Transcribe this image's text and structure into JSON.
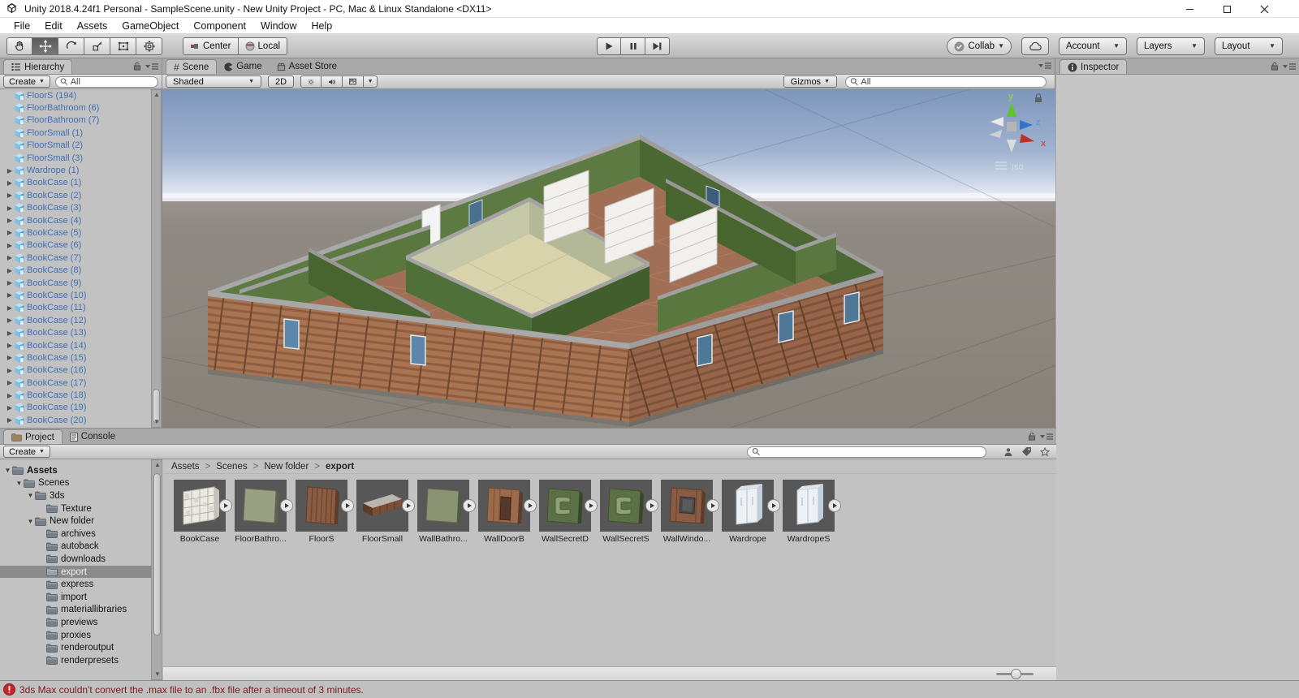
{
  "window": {
    "title": "Unity 2018.4.24f1 Personal - SampleScene.unity - New Unity Project - PC, Mac & Linux Standalone <DX11>"
  },
  "menu": [
    "File",
    "Edit",
    "Assets",
    "GameObject",
    "Component",
    "Window",
    "Help"
  ],
  "toolbar": {
    "tools": [
      "hand",
      "move",
      "rotate",
      "scale",
      "rect",
      "transform"
    ],
    "active_tool": "move",
    "pivot_label": "Center",
    "orientation_label": "Local",
    "collab_label": "Collab",
    "account_label": "Account",
    "layers_label": "Layers",
    "layout_label": "Layout"
  },
  "hierarchy": {
    "tab": "Hierarchy",
    "create_label": "Create",
    "search_value": "All",
    "items": [
      {
        "label": "FloorS (194)",
        "arrow": false
      },
      {
        "label": "FloorBathroom (6)",
        "arrow": false
      },
      {
        "label": "FloorBathroom (7)",
        "arrow": false
      },
      {
        "label": "FloorSmall (1)",
        "arrow": false
      },
      {
        "label": "FloorSmall (2)",
        "arrow": false
      },
      {
        "label": "FloorSmall (3)",
        "arrow": false
      },
      {
        "label": "Wardrope (1)",
        "arrow": true
      },
      {
        "label": "BookCase (1)",
        "arrow": true
      },
      {
        "label": "BookCase (2)",
        "arrow": true
      },
      {
        "label": "BookCase (3)",
        "arrow": true
      },
      {
        "label": "BookCase (4)",
        "arrow": true
      },
      {
        "label": "BookCase (5)",
        "arrow": true
      },
      {
        "label": "BookCase (6)",
        "arrow": true
      },
      {
        "label": "BookCase (7)",
        "arrow": true
      },
      {
        "label": "BookCase (8)",
        "arrow": true
      },
      {
        "label": "BookCase (9)",
        "arrow": true
      },
      {
        "label": "BookCase (10)",
        "arrow": true
      },
      {
        "label": "BookCase (11)",
        "arrow": true
      },
      {
        "label": "BookCase (12)",
        "arrow": true
      },
      {
        "label": "BookCase (13)",
        "arrow": true
      },
      {
        "label": "BookCase (14)",
        "arrow": true
      },
      {
        "label": "BookCase (15)",
        "arrow": true
      },
      {
        "label": "BookCase (16)",
        "arrow": true
      },
      {
        "label": "BookCase (17)",
        "arrow": true
      },
      {
        "label": "BookCase (18)",
        "arrow": true
      },
      {
        "label": "BookCase (19)",
        "arrow": true
      },
      {
        "label": "BookCase (20)",
        "arrow": true
      }
    ]
  },
  "scene": {
    "tabs": [
      "Scene",
      "Game",
      "Asset Store"
    ],
    "shading_label": "Shaded",
    "toggle_2d": "2D",
    "gizmos_label": "Gizmos",
    "search_value": "All",
    "axis_labels": {
      "x": "x",
      "y": "y",
      "z": "z"
    },
    "view_mode_label": "Iso"
  },
  "inspector": {
    "tab": "Inspector"
  },
  "project": {
    "tabs": [
      "Project",
      "Console"
    ],
    "create_label": "Create",
    "search_value": "",
    "breadcrumb": [
      "Assets",
      "Scenes",
      "New folder",
      "export"
    ],
    "breadcrumb_sep": ">",
    "tree": [
      {
        "label": "Assets",
        "depth": 0,
        "expanded": true,
        "bold": true,
        "selected": false
      },
      {
        "label": "Scenes",
        "depth": 1,
        "expanded": true,
        "bold": false,
        "selected": false
      },
      {
        "label": "3ds",
        "depth": 2,
        "expanded": true,
        "bold": false,
        "selected": false
      },
      {
        "label": "Texture",
        "depth": 3,
        "expanded": null,
        "bold": false,
        "selected": false
      },
      {
        "label": "New folder",
        "depth": 2,
        "expanded": true,
        "bold": false,
        "selected": false
      },
      {
        "label": "archives",
        "depth": 3,
        "expanded": null,
        "bold": false,
        "selected": false
      },
      {
        "label": "autoback",
        "depth": 3,
        "expanded": null,
        "bold": false,
        "selected": false
      },
      {
        "label": "downloads",
        "depth": 3,
        "expanded": null,
        "bold": false,
        "selected": false
      },
      {
        "label": "export",
        "depth": 3,
        "expanded": null,
        "bold": false,
        "selected": true
      },
      {
        "label": "express",
        "depth": 3,
        "expanded": null,
        "bold": false,
        "selected": false
      },
      {
        "label": "import",
        "depth": 3,
        "expanded": null,
        "bold": false,
        "selected": false
      },
      {
        "label": "materiallibraries",
        "depth": 3,
        "expanded": null,
        "bold": false,
        "selected": false
      },
      {
        "label": "previews",
        "depth": 3,
        "expanded": null,
        "bold": false,
        "selected": false
      },
      {
        "label": "proxies",
        "depth": 3,
        "expanded": null,
        "bold": false,
        "selected": false
      },
      {
        "label": "renderoutput",
        "depth": 3,
        "expanded": null,
        "bold": false,
        "selected": false
      },
      {
        "label": "renderpresets",
        "depth": 3,
        "expanded": null,
        "bold": false,
        "selected": false
      }
    ],
    "assets": [
      {
        "label": "BookCase",
        "kind": "bookcase"
      },
      {
        "label": "FloorBathro...",
        "kind": "floor-green"
      },
      {
        "label": "FloorS",
        "kind": "floor-planks"
      },
      {
        "label": "FloorSmall",
        "kind": "floor-small"
      },
      {
        "label": "WallBathro...",
        "kind": "wall-green"
      },
      {
        "label": "WallDoorB",
        "kind": "wall-door"
      },
      {
        "label": "WallSecretD",
        "kind": "wall-secret"
      },
      {
        "label": "WallSecretS",
        "kind": "wall-secret"
      },
      {
        "label": "WallWindo...",
        "kind": "wall-window"
      },
      {
        "label": "Wardrope",
        "kind": "wardrobe"
      },
      {
        "label": "WardropeS",
        "kind": "wardrobe"
      }
    ]
  },
  "status": {
    "error_message": "3ds Max couldn't convert the .max file to an .fbx file after a timeout of 3 minutes."
  },
  "colors": {
    "prefab_text_blue": "#3f6fb5",
    "error_text": "#7a1a1a",
    "error_icon": "#c62828",
    "selection_gray": "#8b8b8b",
    "axis_x": "#c03028",
    "axis_y": "#61c22c",
    "axis_z": "#3073c8"
  }
}
